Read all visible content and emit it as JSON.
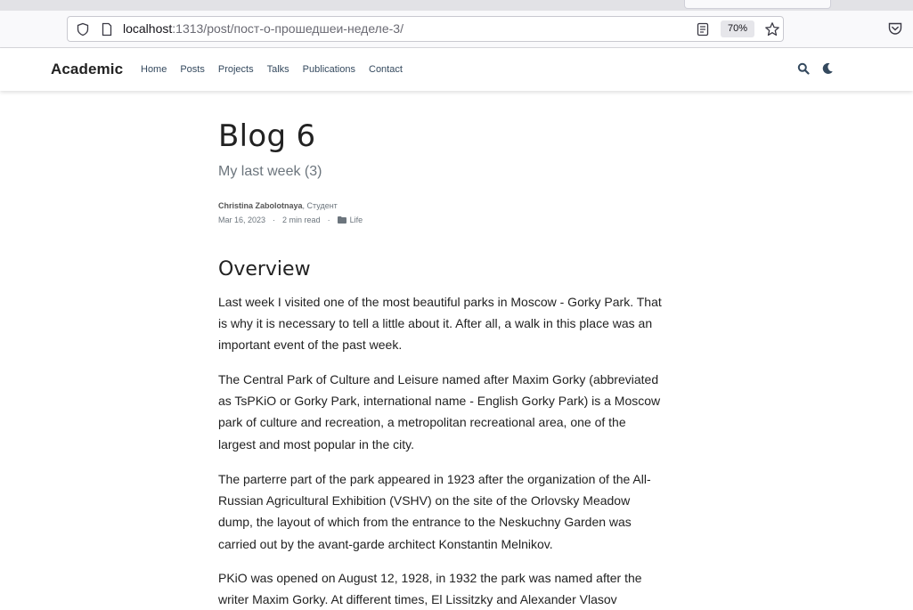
{
  "browser": {
    "url_host": "localhost",
    "url_path": ":1313/post/пост-о-прошедшеи-неделе-3/",
    "zoom": "70%"
  },
  "site": {
    "brand": "Academic",
    "nav": [
      "Home",
      "Posts",
      "Projects",
      "Talks",
      "Publications",
      "Contact"
    ]
  },
  "post": {
    "title": "Blog 6",
    "subtitle": "My last week (3)",
    "author": "Christina Zabolotnaya",
    "author_role": ", Студент",
    "date": "Mar 16, 2023",
    "read_time": "2 min read",
    "category": "Life",
    "dot": "·",
    "section_heading": "Overview",
    "paragraphs": [
      "Last week I visited one of the most beautiful parks in Moscow - Gorky Park. That is why it is necessary to tell a little about it. After all, a walk in this place was an important event of the past week.",
      "The Central Park of Culture and Leisure named after Maxim Gorky (abbreviated as TsPKiO or Gorky Park, international name - English Gorky Park) is a Moscow park of culture and recreation, a metropolitan recreational area, one of the largest and most popular in the city.",
      "The parterre part of the park appeared in 1923 after the organization of the All-Russian Agricultural Exhibition (VSHV) on the site of the Orlovsky Meadow dump, the layout of which from the entrance to the Neskuchny Garden was carried out by the avant-garde architect Konstantin Melnikov.",
      "PKiO was opened on August 12, 1928, in 1932 the park was named after the writer Maxim Gorky. At different times, El Lissitzky and Alexander Vlasov"
    ]
  },
  "colors": {
    "nav_link": "#34495e",
    "text": "#222222",
    "muted": "#6c757d"
  }
}
